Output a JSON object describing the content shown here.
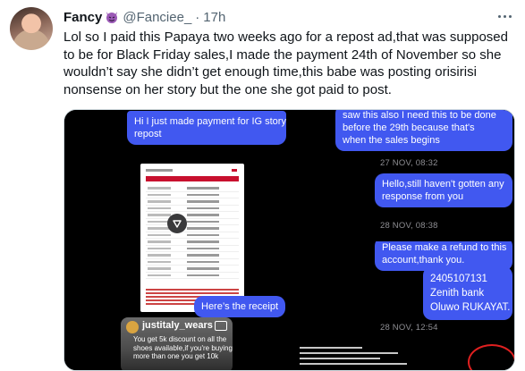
{
  "tweet": {
    "author_name": "Fancy",
    "author_handle": "@Fanciee_",
    "separator": "·",
    "time": "17h",
    "text_lines": [
      "Lol so I paid this Papaya two weeks ago for a repost ad,that was supposed",
      "to be for Black Friday sales,I made the payment 24th of November so she",
      "wouldn’t say she didn’t get enough time,this babe was posting orisirisi",
      "nonsense on her story but the one she got paid to post."
    ]
  },
  "media": {
    "panel1": {
      "bubble_top": [
        "Hi I just made payment for IG story",
        "repost"
      ],
      "bubble_bottom": "Here’s the receipt",
      "story_handle": "justitaly_wears",
      "story_text": [
        "You get 5k discount on all the",
        "shoes available,if you're buying",
        "more than one you get 10k"
      ]
    },
    "panel2": {
      "bubble_top": [
        "saw this also I need this to be done",
        "before the 29th because that's",
        "when the sales begins"
      ],
      "stamp1": "27 NOV, 08:32",
      "bubble_mid": [
        "Hello,still haven't gotten any",
        "response from you"
      ],
      "stamp2": "28 NOV, 08:38"
    },
    "panel3": {
      "bubble_top": [
        "Please make a refund to this",
        "account,thank you."
      ],
      "bubble_account": [
        "2405107131",
        "Zenith bank",
        "Oluwo RUKAYAT."
      ],
      "stamp": "28 NOV, 12:54"
    }
  },
  "colors": {
    "bubble": "#4158f0",
    "text_primary": "#0f1419",
    "text_secondary": "#536471"
  },
  "icons": {
    "author_badge": "devil-emoji-icon",
    "menu": "more-options-icon",
    "media_overlay": "play-icon"
  }
}
